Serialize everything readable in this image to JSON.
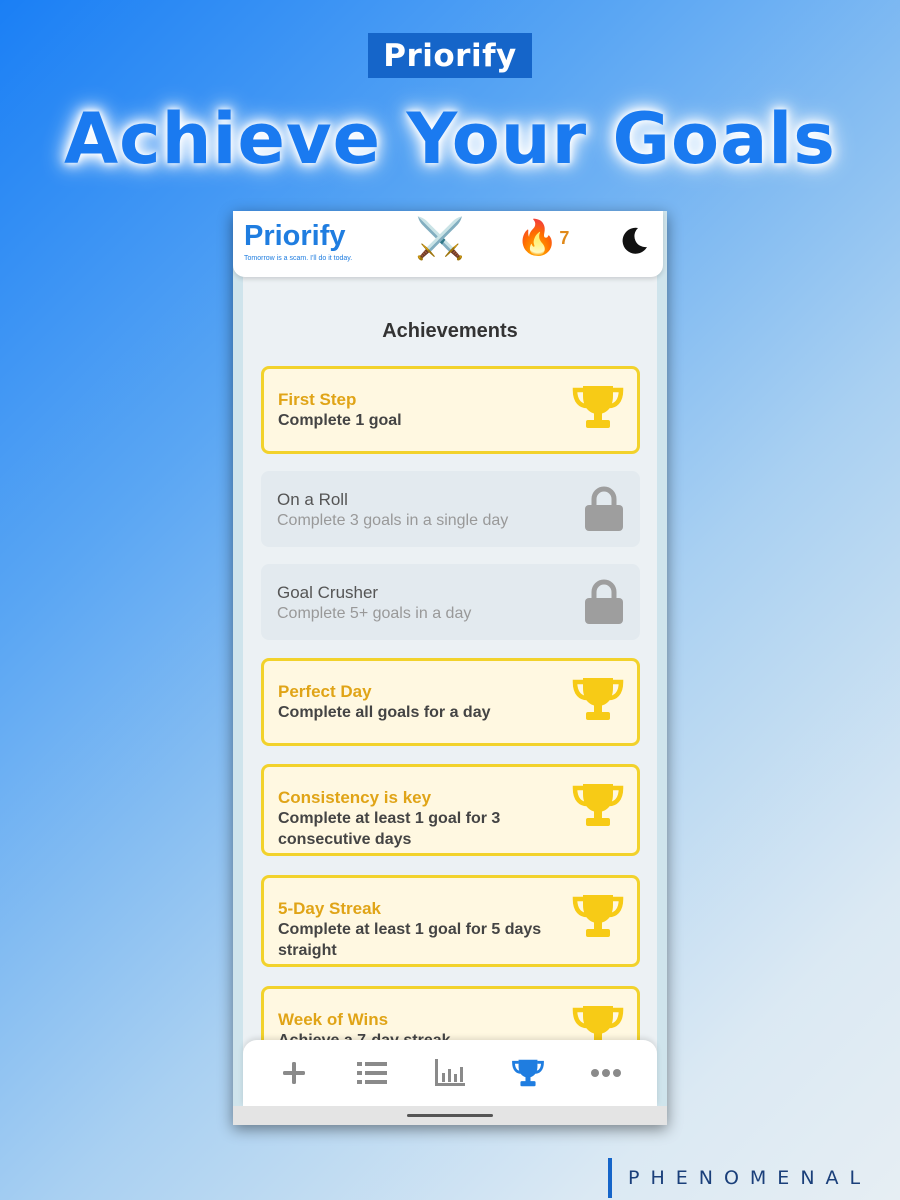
{
  "promo": {
    "brand": "Priorify",
    "headline": "Achieve Your Goals",
    "footer_brand": "PHENOMENAL"
  },
  "app_header": {
    "logo": "Priorify",
    "tagline": "Tomorrow is a scam. I'll do it today.",
    "battle_icon": "crossed-swords",
    "streak_icon": "fire",
    "streak_count": "7",
    "theme_icon": "moon"
  },
  "page": {
    "title": "Achievements"
  },
  "achievements": [
    {
      "title": "First Step",
      "description": "Complete 1 goal",
      "status": "unlocked",
      "icon": "trophy"
    },
    {
      "title": "On a Roll",
      "description": "Complete 3 goals in a single day",
      "status": "locked",
      "icon": "lock"
    },
    {
      "title": "Goal Crusher",
      "description": "Complete 5+ goals in a day",
      "status": "locked",
      "icon": "lock"
    },
    {
      "title": "Perfect Day",
      "description": "Complete all goals for a day",
      "status": "unlocked",
      "icon": "trophy"
    },
    {
      "title": "Consistency is key",
      "description": "Complete at least 1 goal for 3 consecutive days",
      "status": "unlocked",
      "icon": "trophy"
    },
    {
      "title": "5-Day Streak",
      "description": "Complete at least 1 goal for 5 days straight",
      "status": "unlocked",
      "icon": "trophy"
    },
    {
      "title": "Week of Wins",
      "description": "Achieve a 7-day streak",
      "status": "unlocked",
      "icon": "trophy"
    }
  ],
  "bottom_nav": [
    {
      "name": "add",
      "icon": "plus-icon",
      "active": false
    },
    {
      "name": "list",
      "icon": "list-icon",
      "active": false
    },
    {
      "name": "stats",
      "icon": "chart-icon",
      "active": false
    },
    {
      "name": "achievements",
      "icon": "trophy-icon",
      "active": true
    },
    {
      "name": "more",
      "icon": "more-icon",
      "active": false
    }
  ],
  "colors": {
    "accent": "#1f7de0",
    "trophy": "#f7cb16",
    "card_border": "#f2d22b",
    "card_title": "#e0a417",
    "lock": "#9e9e9e",
    "nav_inactive": "#8a8a8a"
  }
}
